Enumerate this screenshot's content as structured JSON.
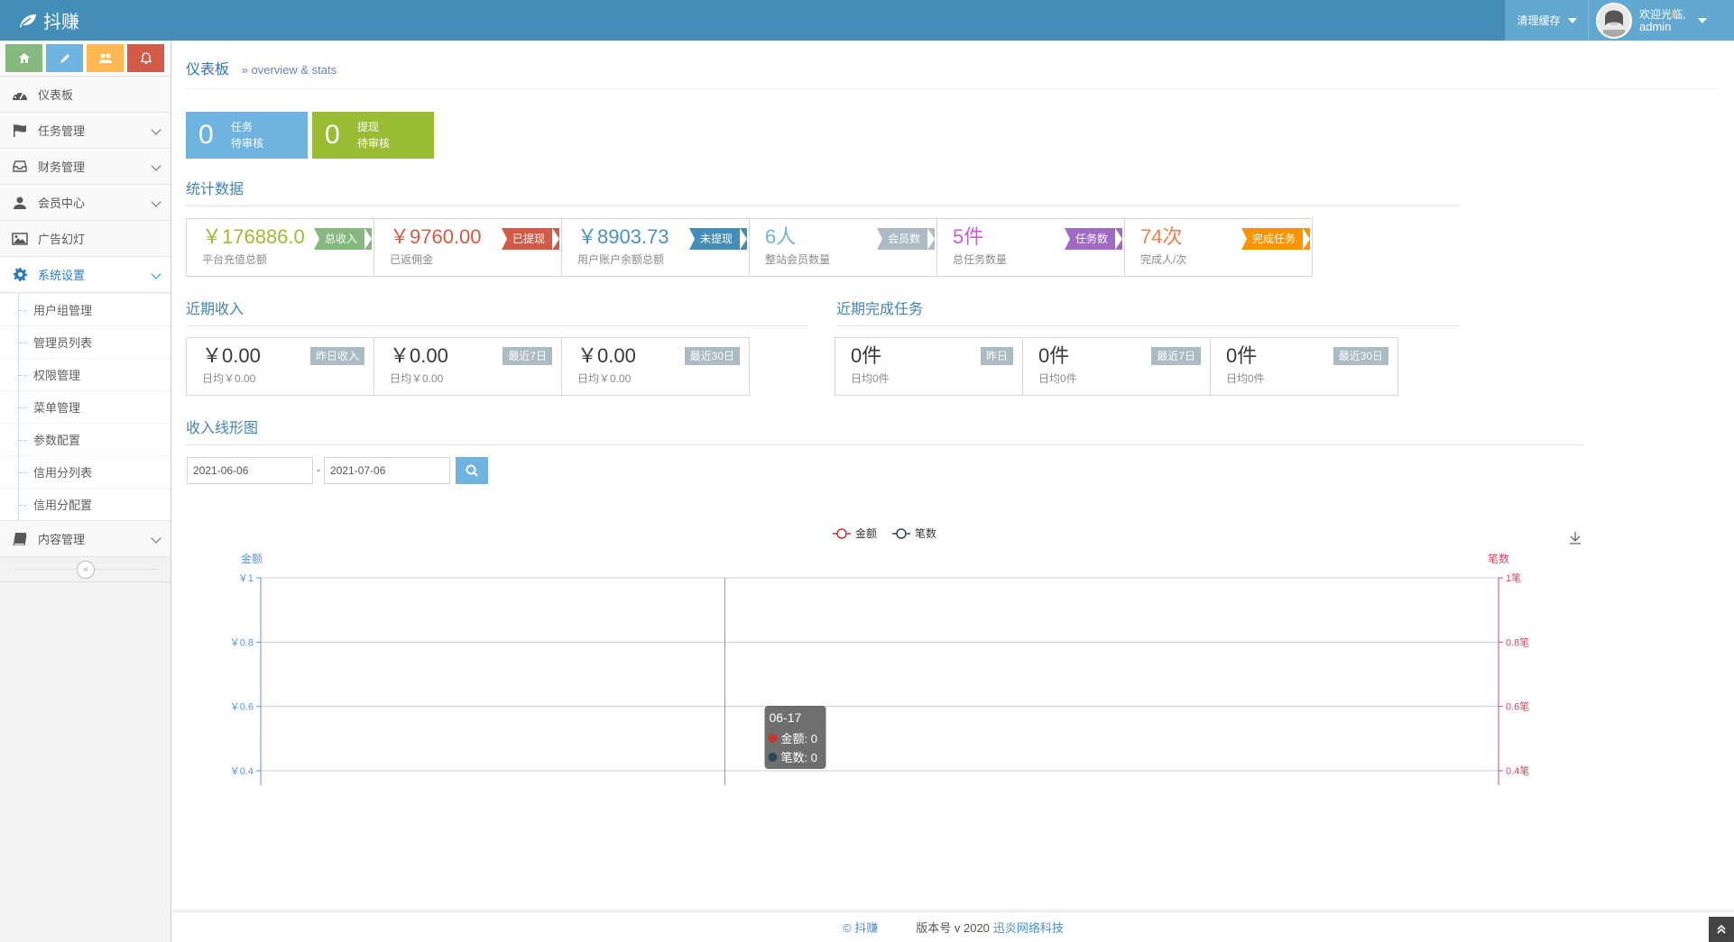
{
  "brand": {
    "title": "抖赚"
  },
  "navbar": {
    "clear_cache": "清理缓存",
    "welcome": "欢迎光临,",
    "username": "admin"
  },
  "sidebar": {
    "items": [
      {
        "label": "仪表板"
      },
      {
        "label": "任务管理"
      },
      {
        "label": "财务管理"
      },
      {
        "label": "会员中心"
      },
      {
        "label": "广告幻灯"
      },
      {
        "label": "系统设置"
      },
      {
        "label": "内容管理"
      }
    ],
    "submenu": [
      "用户组管理",
      "管理员列表",
      "权限管理",
      "菜单管理",
      "参数配置",
      "信用分列表",
      "信用分配置"
    ]
  },
  "header": {
    "title": "仪表板",
    "subtitle": "» overview & stats"
  },
  "pending": [
    {
      "num": "0",
      "line1": "任务",
      "line2": "待审核"
    },
    {
      "num": "0",
      "line1": "提现",
      "line2": "待审核"
    }
  ],
  "sections": {
    "stats": "统计数据",
    "income": "近期收入",
    "tasks": "近期完成任务",
    "chart": "收入线形图"
  },
  "stats": [
    {
      "value": "￥176886.0",
      "sub": "平台充值总额",
      "badge": "总收入"
    },
    {
      "value": "￥9760.00",
      "sub": "已返佣金",
      "badge": "已提现"
    },
    {
      "value": "￥8903.73",
      "sub": "用户账户余额总额",
      "badge": "未提现"
    },
    {
      "value": "6人",
      "sub": "整站会员数量",
      "badge": "会员数"
    },
    {
      "value": "5件",
      "sub": "总任务数量",
      "badge": "任务数"
    },
    {
      "value": "74次",
      "sub": "完成人/次",
      "badge": "完成任务"
    }
  ],
  "income": [
    {
      "value": "￥0.00",
      "sub": "日均￥0.00",
      "badge": "昨日收入"
    },
    {
      "value": "￥0.00",
      "sub": "日均￥0.00",
      "badge": "最近7日"
    },
    {
      "value": "￥0.00",
      "sub": "日均￥0.00",
      "badge": "最近30日"
    }
  ],
  "tasks": [
    {
      "value": "0件",
      "sub": "日均0件",
      "badge": "昨日"
    },
    {
      "value": "0件",
      "sub": "日均0件",
      "badge": "最近7日"
    },
    {
      "value": "0件",
      "sub": "日均0件",
      "badge": "最近30日"
    }
  ],
  "filter": {
    "start": "2021-06-06",
    "sep": "-",
    "end": "2021-07-06"
  },
  "chart_data": {
    "type": "line",
    "x": [
      "06-17"
    ],
    "series": [
      {
        "name": "金额",
        "values": [
          0
        ]
      },
      {
        "name": "笔数",
        "values": [
          0
        ]
      }
    ],
    "ylabel": "金额",
    "y2label": "笔数",
    "yticks": [
      "￥1",
      "￥0.8",
      "￥0.6",
      "￥0.4"
    ],
    "y2ticks": [
      "1笔",
      "0.8笔",
      "0.6笔",
      "0.4笔"
    ],
    "ylim": [
      0.4,
      1
    ],
    "legend": "top-center",
    "tooltip": {
      "date": "06-17",
      "line1": "金额: 0",
      "line2": "笔数: 0"
    },
    "colors": {
      "amount": "#c23531",
      "count": "#2f4554",
      "left_axis": "#5793f3",
      "right_axis": "#d14a61"
    }
  },
  "footer": {
    "copyright": "© 抖赚",
    "version": "版本号 v 2020",
    "company": "迅炎网络科技"
  }
}
